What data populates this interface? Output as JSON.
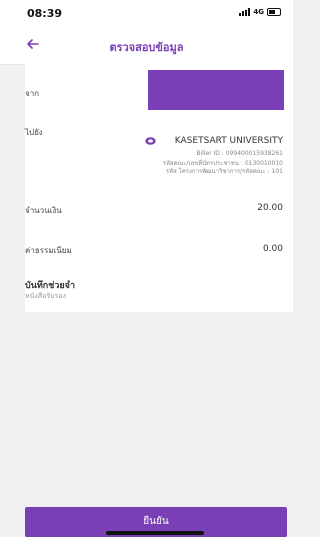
{
  "status_bar": {
    "time": "08:39",
    "network": "4G"
  },
  "nav": {
    "back_icon": "back-arrow-icon",
    "title": "ตรวจสอบข้อมูล"
  },
  "from": {
    "label": "จาก"
  },
  "to": {
    "label": "ไปยัง",
    "icon": "university-logo-icon",
    "name": "KASETSART UNIVERSITY",
    "biller_id": "Biller ID : 099400015938261",
    "ref1": "รหัสคณะ/เลขที่บัตรประชาชน : 0130010010",
    "ref2": "รหัส โครงการพัฒนาวิชาการ/รหัสคณะ : 101"
  },
  "amount": {
    "label": "จำนวนเงิน",
    "value": "20.00"
  },
  "fee": {
    "label": "ค่าธรรมเนียม",
    "value": "0.00"
  },
  "memo": {
    "label": "บันทึกช่วยจำ",
    "value": "หนังสือรับรอง"
  },
  "confirm_button": {
    "label": "ยืนยัน"
  },
  "colors": {
    "accent": "#7b3fb5",
    "background": "#f1f1f4"
  }
}
